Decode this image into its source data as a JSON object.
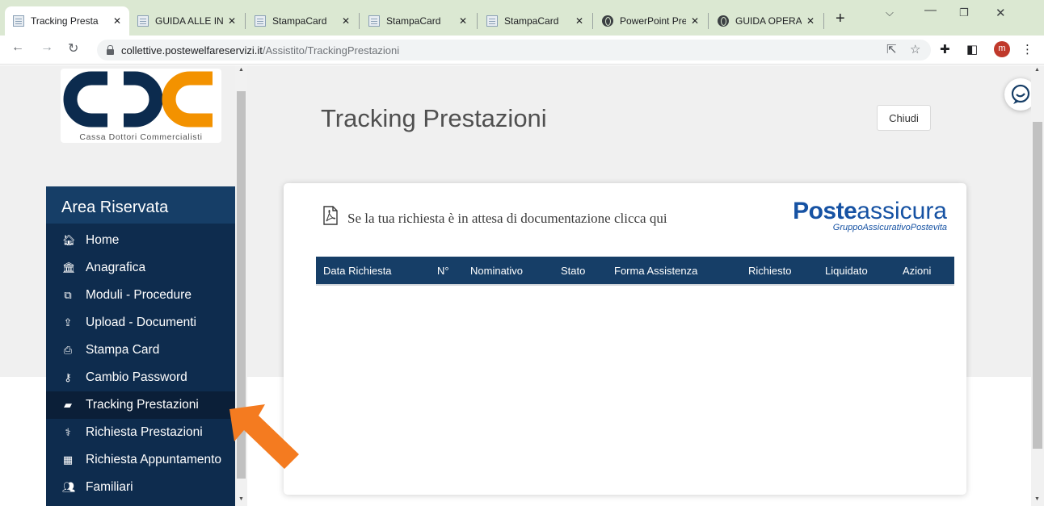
{
  "browser": {
    "tabs": [
      {
        "title": "Tracking Presta",
        "icon": "doc",
        "active": true
      },
      {
        "title": "GUIDA ALLE IN",
        "icon": "doc",
        "active": false
      },
      {
        "title": "StampaCard",
        "icon": "doc",
        "active": false
      },
      {
        "title": "StampaCard",
        "icon": "doc",
        "active": false
      },
      {
        "title": "StampaCard",
        "icon": "doc",
        "active": false
      },
      {
        "title": "PowerPoint Pre",
        "icon": "globe",
        "active": false
      },
      {
        "title": "GUIDA OPERAT",
        "icon": "globe",
        "active": false
      }
    ],
    "tab_close_symbol": "✕",
    "new_tab_symbol": "+",
    "url_host": "collettive.postewelfareservizi.it",
    "url_path": "/Assistito/TrackingPrestazioni",
    "profile_initial": "m",
    "profile_color": "#c0392b"
  },
  "logo": {
    "caption": "Cassa Dottori Commercialisti",
    "colors": {
      "navy": "#0c2b4e",
      "orange": "#f39200"
    }
  },
  "sidebar": {
    "header": "Area Riservata",
    "items": [
      {
        "label": "Home",
        "icon": "home-icon",
        "glyph": "🏠︎",
        "active": false
      },
      {
        "label": "Anagrafica",
        "icon": "institution-icon",
        "glyph": "🏛︎",
        "active": false
      },
      {
        "label": "Moduli - Procedure",
        "icon": "copy-icon",
        "glyph": "⧉",
        "active": false
      },
      {
        "label": "Upload - Documenti",
        "icon": "upload-icon",
        "glyph": "⇪",
        "active": false
      },
      {
        "label": "Stampa Card",
        "icon": "print-icon",
        "glyph": "⎙",
        "active": false
      },
      {
        "label": "Cambio Password",
        "icon": "key-icon",
        "glyph": "⚷",
        "active": false
      },
      {
        "label": "Tracking Prestazioni",
        "icon": "book-icon",
        "glyph": "▰",
        "active": true
      },
      {
        "label": "Richiesta Prestazioni",
        "icon": "stethoscope-icon",
        "glyph": "⚕",
        "active": false
      },
      {
        "label": "Richiesta Appuntamento",
        "icon": "calendar-icon",
        "glyph": "▦",
        "active": false
      },
      {
        "label": "Familiari",
        "icon": "users-icon",
        "glyph": "👥︎",
        "active": false
      }
    ],
    "colors": {
      "background": "#0e2c4e",
      "header": "#163e67",
      "active": "#0b1f38"
    }
  },
  "main": {
    "title": "Tracking Prestazioni",
    "close_button": "Chiudi",
    "notice": "Se la tua richiesta è in attesa di documentazione clicca qui",
    "brand": {
      "bold": "Poste",
      "regular": "assicura",
      "sub": "GruppoAssicurativoPostevita",
      "color": "#1652a3"
    },
    "table": {
      "columns": [
        "Data Richiesta",
        "N°",
        "Nominativo",
        "Stato",
        "Forma Assistenza",
        "Richiesto",
        "Liquidato",
        "Azioni"
      ],
      "rows": []
    }
  },
  "annotation": {
    "arrow_color": "#f47b20",
    "points_to": "Tracking Prestazioni"
  }
}
